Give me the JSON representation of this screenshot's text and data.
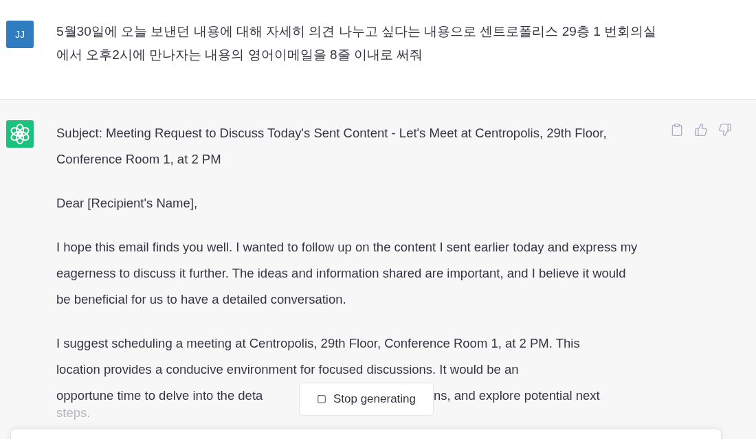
{
  "user_message": {
    "avatar": "JJ",
    "text": "5월30일에 오늘 보낸던 내용에 대해 자세히 의견 나누고 싶다는 내용으로 센트로폴리스 29층 1 번회의실에서 오후2시에 만나자는 내용의 영어이메일을 8줄 이내로 써줘"
  },
  "assistant_message": {
    "paragraphs": [
      {
        "text": "Subject: Meeting Request to Discuss Today's Sent Content - Let's Meet at Centropolis, 29th Floor, Conference Room 1, at 2 PM"
      },
      {
        "text": "Dear [Recipient's Name],"
      },
      {
        "text": "I hope this email finds you well. I wanted to follow up on the content I sent earlier today and express my eagerness to discuss it further. The ideas and information shared are important, and I believe it would be beneficial for us to have a detailed conversation."
      }
    ],
    "last_paragraph": {
      "lines": [
        "I suggest scheduling a meeting at Centropolis, 29th Floor, Conference Room 1, at 2 PM. This",
        "location provides a conducive environment for focused discussions. It would be an"
      ],
      "covered_line_left": "opportune time to delve into the deta",
      "covered_line_right": "ns, and explore potential next",
      "faded_line": "steps."
    }
  },
  "stop_button": {
    "label": "Stop generating"
  }
}
